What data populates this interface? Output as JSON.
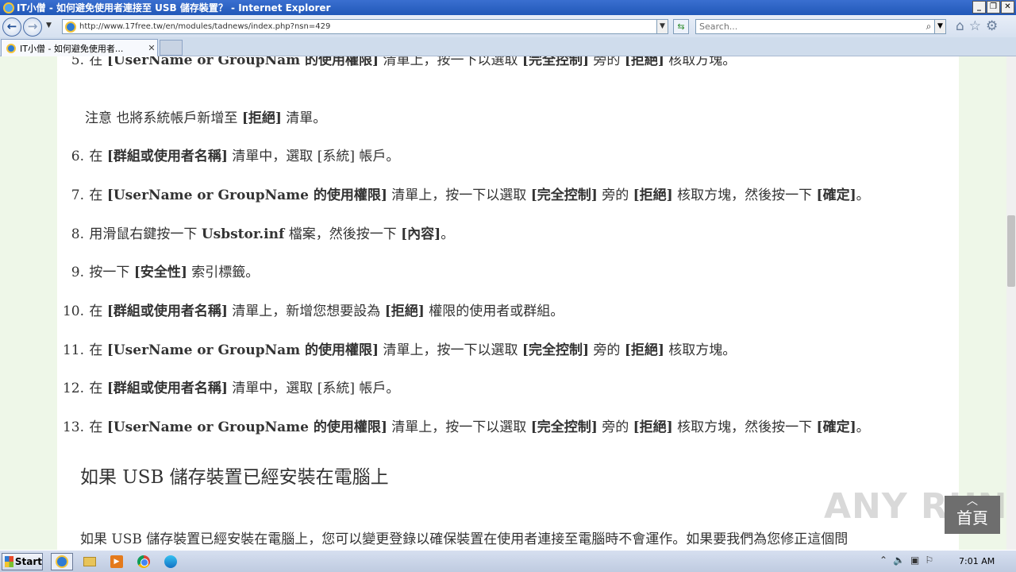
{
  "window": {
    "title": "IT小僧 - 如何避免使用者連接至 USB 儲存裝置？ - Internet Explorer",
    "buttons": [
      "_",
      "❐",
      "✕"
    ]
  },
  "address_bar": {
    "url": "http://www.17free.tw/en/modules/tadnews/index.php?nsn=429",
    "search_placeholder": "Search..."
  },
  "tabs": [
    {
      "label": "IT小僧 - 如何避免使用者..."
    }
  ],
  "content": {
    "step5_partial": {
      "num": "5.",
      "pre": "在 ",
      "b1": "[UserName or GroupNam 的使用權限]",
      "mid1": " 清單上，按一下以選取 ",
      "b2": "[完全控制]",
      "mid2": " 旁的 ",
      "b3": "[拒絕]",
      "post": " 核取方塊。"
    },
    "note": {
      "pre": "注意 也將系統帳戶新增至 ",
      "b1": "[拒絕]",
      "post": " 清單。"
    },
    "step6": {
      "num": "6.",
      "pre": "在 ",
      "b1": "[群組或使用者名稱]",
      "mid1": " 清單中，選取 [系統] 帳戶。"
    },
    "step7": {
      "num": "7.",
      "pre": "在 ",
      "b1": "[UserName or GroupName 的使用權限]",
      "mid1": " 清單上，按一下以選取 ",
      "b2": "[完全控制]",
      "mid2": " 旁的 ",
      "b3": "[拒絕]",
      "mid3": " 核取方塊，然後按一下 ",
      "b4": "[確定]",
      "post": "。"
    },
    "step8": {
      "num": "8.",
      "pre": "用滑鼠右鍵按一下 ",
      "b1": "Usbstor.inf",
      "mid1": " 檔案，然後按一下 ",
      "b2": "[內容]",
      "post": "。"
    },
    "step9": {
      "num": "9.",
      "pre": "按一下 ",
      "b1": "[安全性]",
      "post": " 索引標籤。"
    },
    "step10": {
      "num": "10.",
      "pre": "在 ",
      "b1": "[群組或使用者名稱]",
      "mid1": " 清單上，新增您想要設為 ",
      "b2": "[拒絕]",
      "post": " 權限的使用者或群組。"
    },
    "step11": {
      "num": "11.",
      "pre": "在 ",
      "b1": "[UserName or GroupNam 的使用權限]",
      "mid1": " 清單上，按一下以選取 ",
      "b2": "[完全控制]",
      "mid2": " 旁的 ",
      "b3": "[拒絕]",
      "post": " 核取方塊。"
    },
    "step12": {
      "num": "12.",
      "pre": "在 ",
      "b1": "[群組或使用者名稱]",
      "mid1": " 清單中，選取 [系統] 帳戶。"
    },
    "step13": {
      "num": "13.",
      "pre": "在 ",
      "b1": "[UserName or GroupName 的使用權限]",
      "mid1": " 清單上，按一下以選取 ",
      "b2": "[完全控制]",
      "mid2": " 旁的 ",
      "b3": "[拒絕]",
      "mid3": " 核取方塊，然後按一下 ",
      "b4": "[確定]",
      "post": "。"
    },
    "heading": "如果 USB 儲存裝置已經安裝在電腦上",
    "paragraph": "如果 USB 儲存裝置已經安裝在電腦上，您可以變更登錄以確保裝置在使用者連接至電腦時不會運作。如果要我們為您修正這個問"
  },
  "top_button": {
    "label": "首頁",
    "arrow": "︿"
  },
  "watermark": "ANY RUN",
  "taskbar": {
    "start_label": "Start",
    "clock": "7:01 AM"
  }
}
